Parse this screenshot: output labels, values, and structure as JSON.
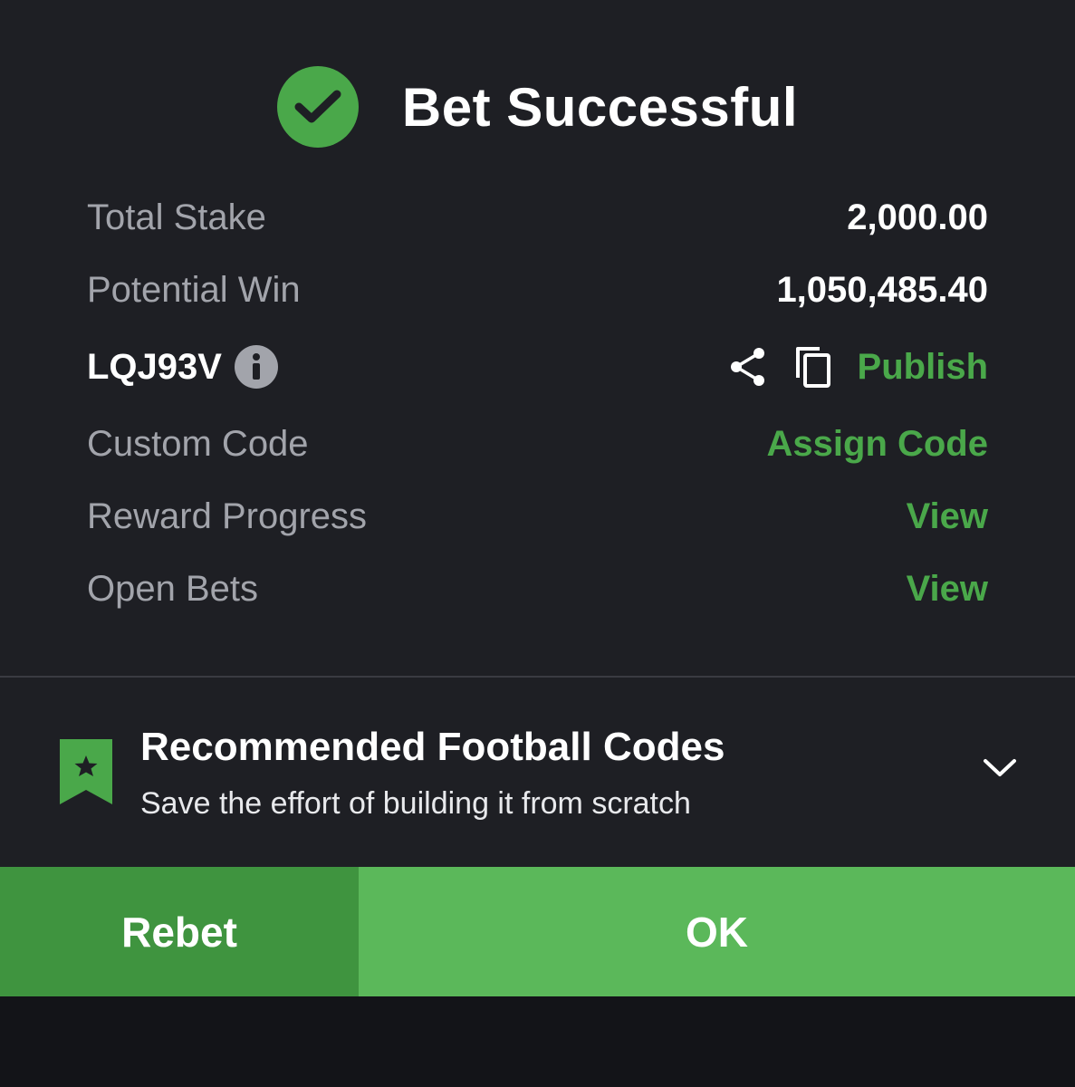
{
  "header": {
    "title": "Bet Successful",
    "check_icon": "check-circle-icon",
    "accent_color": "#4aa84a"
  },
  "summary": {
    "total_stake_label": "Total Stake",
    "total_stake_value": "2,000.00",
    "potential_win_label": "Potential Win",
    "potential_win_value": "1,050,485.40",
    "booking_code": "LQJ93V",
    "publish_label": "Publish",
    "custom_code_label": "Custom Code",
    "assign_code_label": "Assign Code",
    "reward_progress_label": "Reward Progress",
    "reward_view_label": "View",
    "open_bets_label": "Open Bets",
    "open_bets_view_label": "View"
  },
  "recommend": {
    "title": "Recommended Football Codes",
    "subtitle": "Save the effort of building it from scratch"
  },
  "actions": {
    "rebet_label": "Rebet",
    "ok_label": "OK"
  }
}
